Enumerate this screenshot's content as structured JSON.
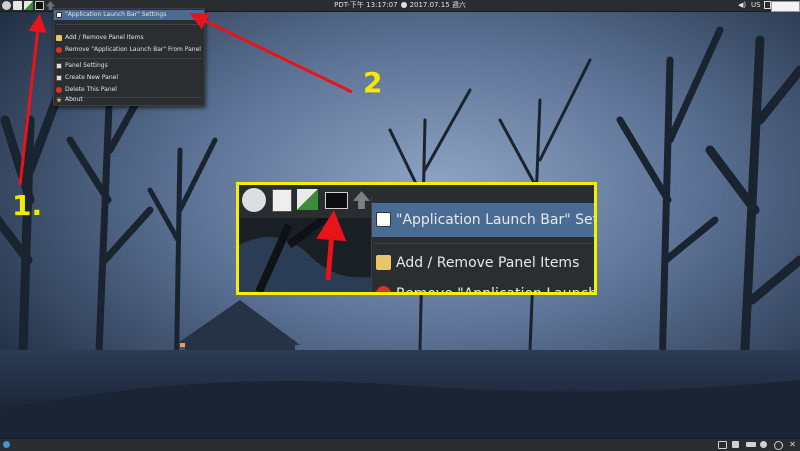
{
  "top_panel": {
    "clock": "PDT-下午 13:17:07",
    "date": "2017.07.15 週六",
    "keyboard_layout": "US"
  },
  "panel_menu": {
    "items": [
      {
        "label": "\"Application Launch Bar\" Settings",
        "icon": "app-settings-icon",
        "highlighted": true
      },
      {
        "label": "Add / Remove Panel Items",
        "icon": "edit-icon"
      },
      {
        "label": "Remove \"Application Launch Bar\" From Panel",
        "icon": "remove-icon"
      },
      {
        "label": "Panel Settings",
        "icon": "panel-settings-icon"
      },
      {
        "label": "Create New Panel",
        "icon": "new-panel-icon"
      },
      {
        "label": "Delete This Panel",
        "icon": "delete-icon"
      },
      {
        "label": "About",
        "icon": "star-icon"
      }
    ]
  },
  "zoom_callout": {
    "items": [
      {
        "label": "\"Application Launch Bar\" Set",
        "icon": "app-settings-icon"
      },
      {
        "label": "Add / Remove Panel Items",
        "icon": "edit-icon"
      },
      {
        "label": "Remove \"Application Launch",
        "icon": "remove-icon"
      }
    ]
  },
  "annotations": {
    "step_1": "1.",
    "step_2": "2"
  },
  "colors": {
    "panel": "#2a2d30",
    "menu_highlight": "#4a6b94",
    "annotation_yellow": "#f4ea00",
    "arrow_red": "#e8141a",
    "callout_border": "#f6f000"
  }
}
